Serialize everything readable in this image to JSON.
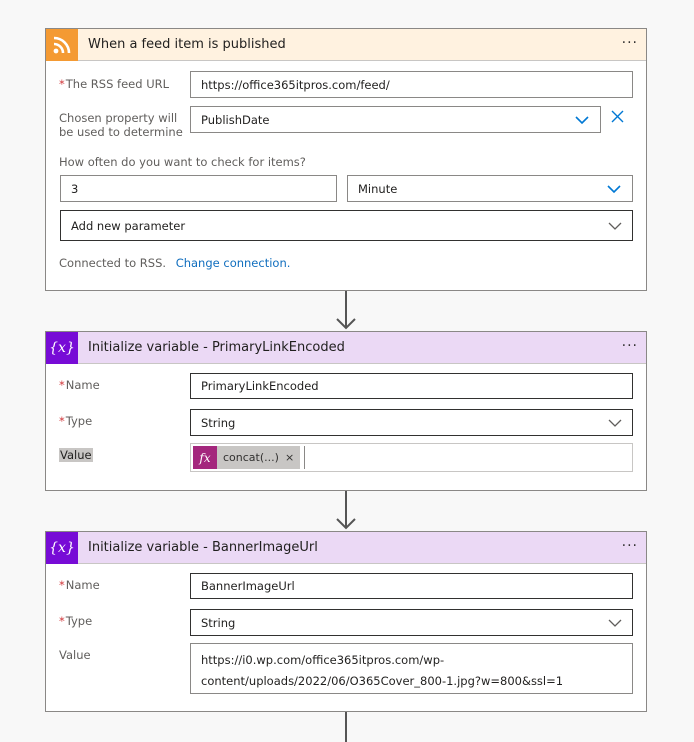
{
  "rss_card": {
    "title": "When a feed item is published",
    "more": "···",
    "feed_url_label": "The RSS feed URL",
    "feed_url_value": "https://office365itpros.com/feed/",
    "chosen_property_label": "Chosen property will be used to determine which items are new",
    "chosen_property_value": "PublishDate",
    "interval_label": "How often do you want to check for items?",
    "interval_value": "3",
    "frequency_value": "Minute",
    "add_param": "Add new parameter",
    "connected_text": "Connected to RSS.",
    "change_connection": "Change connection."
  },
  "var_card_1": {
    "title": "Initialize variable - PrimaryLinkEncoded",
    "more": "···",
    "name_label": "Name",
    "name_value": "PrimaryLinkEncoded",
    "type_label": "Type",
    "type_value": "String",
    "value_label": "Value",
    "token_text": "concat(...)",
    "token_remove": "×"
  },
  "var_card_2": {
    "title": "Initialize variable - BannerImageUrl",
    "more": "···",
    "name_label": "Name",
    "name_value": "BannerImageUrl",
    "type_label": "Type",
    "type_value": "String",
    "value_label": "Value",
    "value_line1": "https://i0.wp.com/office365itpros.com/wp-",
    "value_line2": "content/uploads/2022/06/O365Cover_800-1.jpg?w=800&ssl=1"
  },
  "icons": {
    "rss": "rss-icon",
    "variable": "variable-icon",
    "fx": "fx-icon",
    "required_marker": "*",
    "fx_symbol": "fx",
    "var_symbol": "{x}"
  },
  "colors": {
    "rss_header": "#fff2e0",
    "rss_icon": "#f49a33",
    "var_header": "#ebd9f5",
    "var_icon": "#770bd6",
    "fx_token": "#a4277d",
    "link": "#106ebe",
    "required": "#d13438"
  }
}
